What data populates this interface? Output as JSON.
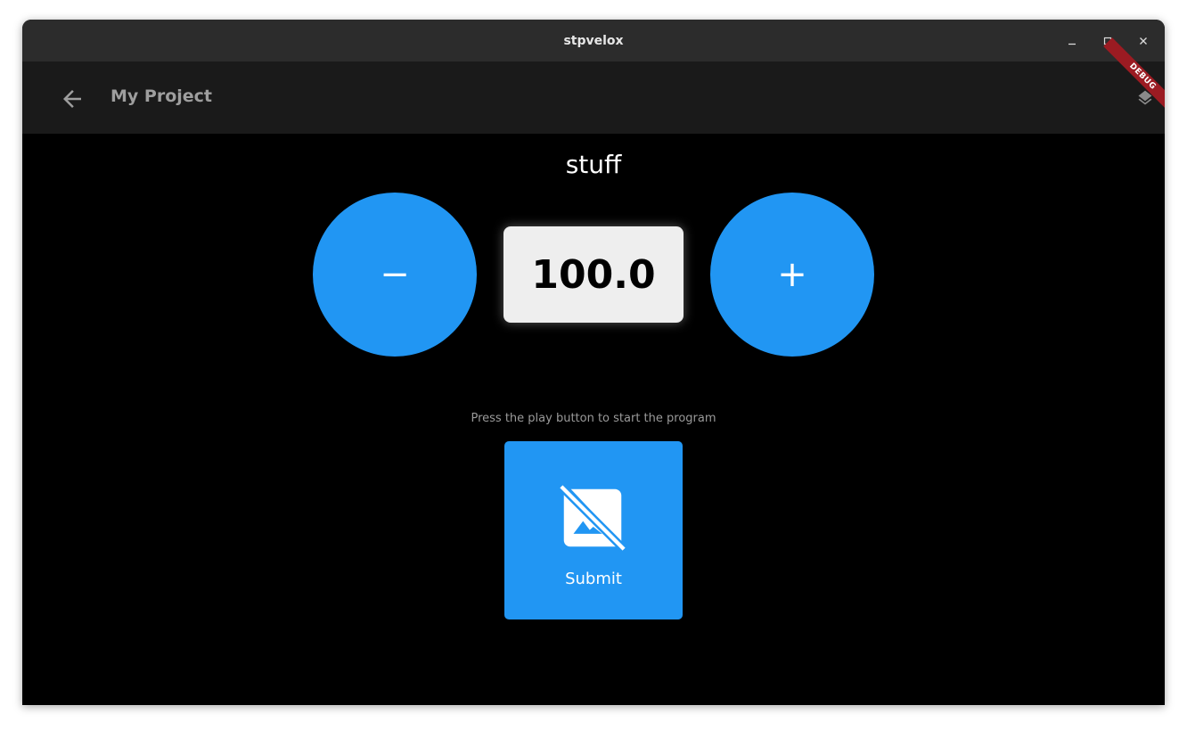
{
  "window": {
    "title": "stpvelox",
    "controls": {
      "minimize_icon": "minimize-icon",
      "maximize_icon": "maximize-icon",
      "close_icon": "close-icon"
    }
  },
  "appbar": {
    "back_icon": "arrow-back-icon",
    "title": "My Project",
    "layers_icon": "layers-icon",
    "debug_banner": "DEBUG"
  },
  "stepper": {
    "label": "stuff",
    "value": "100.0",
    "decrement_label": "−",
    "increment_label": "+"
  },
  "hint": "Press the play button to start the program",
  "submit": {
    "icon": "hide-image-icon",
    "label": "Submit"
  },
  "colors": {
    "accent": "#2196f3",
    "titlebar": "#2c2c2c",
    "appbar": "#1a1a1a",
    "background": "#000000",
    "debug_banner": "#9b1b22"
  }
}
